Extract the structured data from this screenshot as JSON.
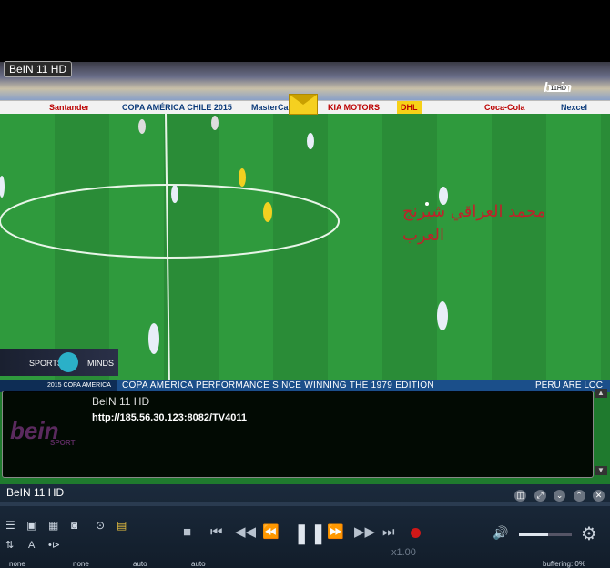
{
  "video": {
    "channel_badge": "BeIN 11 HD",
    "watermark_logo": "bein",
    "watermark_hd": "11HD",
    "overlay_text": "محمد العراقي شيرنج العرب",
    "ads": [
      "Santander",
      "COPA AMÉRICA CHILE 2015",
      "MasterCard",
      "KIA MOTORS",
      "DHL",
      "Coca-Cola",
      "Nexcel"
    ],
    "sports_minds": {
      "left": "SPORTS",
      "right": "MINDS"
    },
    "ticker": {
      "tag": "2015 COPA AMERICA",
      "main": "COPA AMERICA PERFORMANCE SINCE WINNING THE 1979 EDITION",
      "right": "PERU ARE LOC"
    }
  },
  "info_panel": {
    "logo": "bein",
    "logo_sub": "SPORT",
    "title": "BeIN 11 HD",
    "url": "http://185.56.30.123:8082/TV4011"
  },
  "controlbar": {
    "title": "BeIN 11 HD",
    "speed": "x1.00",
    "status": {
      "item1": "none",
      "item2": "none",
      "item3": "auto",
      "item4": "auto",
      "buffering": "buffering: 0%"
    }
  },
  "icons": {
    "envelope": "envelope-icon",
    "pause": "pause-icon",
    "settings": "gear-icon"
  },
  "colors": {
    "accent_record": "#d01818",
    "overlay_text": "#c0202a"
  }
}
